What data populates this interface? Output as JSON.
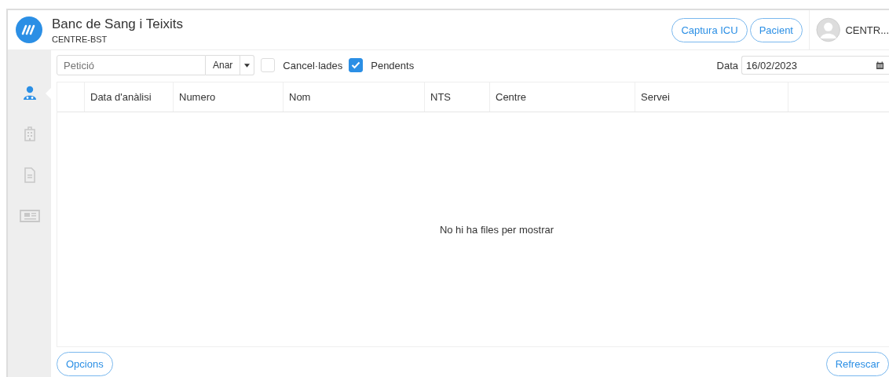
{
  "header": {
    "title": "Banc de Sang i Teixits",
    "subtitle": "CENTRE-BST",
    "buttons": [
      "Captura ICU",
      "Pacient"
    ],
    "user": "CENTR..."
  },
  "sidebar": {
    "items": [
      {
        "kind": "doctor",
        "selected": true
      },
      {
        "kind": "hospital",
        "selected": false
      },
      {
        "kind": "document",
        "selected": false
      },
      {
        "kind": "card",
        "selected": false
      }
    ]
  },
  "toolbar": {
    "search": {
      "placeholder": "Petició"
    },
    "go_button": "Anar",
    "filters": [
      {
        "label": "Cancel·lades",
        "checked": false
      },
      {
        "label": "Pendents",
        "checked": true
      }
    ],
    "date": {
      "label": "Data",
      "value": "16/02/2023"
    }
  },
  "table": {
    "columns": [
      "Data d'anàlisi",
      "Numero",
      "Nom",
      "NTS",
      "Centre",
      "Servei"
    ],
    "empty_message": "No hi ha files per mostrar"
  },
  "footer": {
    "left_button": "Opcions",
    "right_button": "Refrescar"
  }
}
